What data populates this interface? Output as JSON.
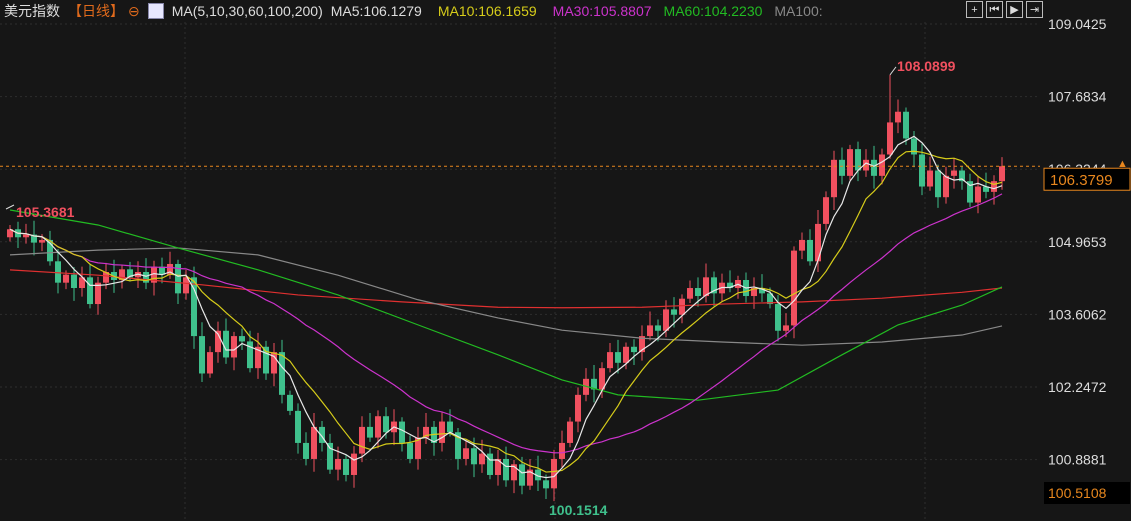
{
  "header": {
    "name": "美元指数",
    "period": "【日线】",
    "ma_label": "MA(5,10,30,60,100,200)",
    "ma5": "MA5:106.1279",
    "ma10": "MA10:106.1659",
    "ma30": "MA30:105.8807",
    "ma60": "MA60:104.2230",
    "ma100": "MA100:"
  },
  "toolbar": {
    "icons": [
      "crosshair-icon",
      "step-back-icon",
      "play-icon",
      "go-end-icon"
    ],
    "glyphs": [
      "+",
      "⏮",
      "▶",
      "⇥"
    ]
  },
  "colors": {
    "up": "#f0505f",
    "down": "#3fc08c",
    "ma5": "#e8e8e8",
    "ma10": "#d6cc1a",
    "ma30": "#cc33cc",
    "ma60": "#22bb22",
    "ma100": "#888888",
    "ma200": "#e03030",
    "accent": "#e8871e"
  },
  "chart_data": {
    "type": "candlestick",
    "yticks": [
      "109.0425",
      "107.6834",
      "106.3244",
      "104.9653",
      "103.6062",
      "102.2472",
      "100.8881"
    ],
    "ylim": [
      99.9,
      109.4
    ],
    "current_price": "106.3799",
    "lower_price": "100.5108",
    "annotations": {
      "high": "108.0899",
      "high_index": 110,
      "low": "100.1514",
      "low_index": 67,
      "left": "105.3681"
    },
    "first_open": 105.05,
    "closes": [
      105.2,
      105.05,
      105.1,
      104.95,
      105.0,
      104.6,
      104.2,
      104.35,
      104.1,
      104.3,
      103.8,
      104.2,
      104.4,
      104.25,
      104.45,
      104.3,
      104.4,
      104.2,
      104.5,
      104.35,
      104.55,
      104.0,
      104.3,
      103.2,
      102.5,
      102.9,
      103.3,
      102.8,
      103.2,
      103.1,
      102.6,
      103.0,
      102.5,
      102.9,
      102.1,
      101.8,
      101.2,
      100.9,
      101.5,
      101.2,
      100.7,
      100.9,
      100.6,
      101.0,
      101.5,
      101.3,
      101.7,
      101.4,
      101.6,
      101.2,
      100.9,
      101.3,
      101.5,
      101.2,
      101.6,
      101.4,
      100.9,
      101.1,
      100.8,
      101.0,
      100.6,
      100.9,
      100.5,
      100.8,
      100.4,
      100.7,
      100.5,
      100.35,
      100.9,
      101.2,
      101.6,
      102.1,
      102.4,
      102.2,
      102.6,
      102.9,
      102.7,
      103.0,
      102.9,
      103.2,
      103.4,
      103.3,
      103.7,
      103.6,
      103.9,
      104.1,
      103.95,
      104.3,
      104.0,
      104.2,
      104.1,
      104.25,
      103.95,
      104.1,
      104.0,
      103.8,
      103.3,
      103.4,
      104.8,
      105.0,
      104.6,
      105.3,
      105.8,
      106.5,
      106.2,
      106.7,
      106.3,
      106.5,
      106.2,
      106.6,
      107.2,
      107.4,
      106.9,
      106.6,
      106.0,
      106.3,
      105.8,
      106.2,
      106.3,
      106.1,
      105.7,
      106.0,
      105.9,
      106.1,
      106.38
    ],
    "ma60": [
      [
        0,
        105.56
      ],
      [
        11,
        105.28
      ],
      [
        21,
        104.85
      ],
      [
        31,
        104.44
      ],
      [
        41,
        103.97
      ],
      [
        51,
        103.41
      ],
      [
        61,
        102.85
      ],
      [
        69,
        102.38
      ],
      [
        76,
        102.1
      ],
      [
        86,
        102.0
      ],
      [
        96,
        102.19
      ],
      [
        104,
        102.85
      ],
      [
        111,
        103.41
      ],
      [
        119,
        103.78
      ],
      [
        124,
        104.12
      ]
    ],
    "ma100": [
      [
        0,
        104.72
      ],
      [
        11,
        104.81
      ],
      [
        21,
        104.85
      ],
      [
        31,
        104.72
      ],
      [
        41,
        104.34
      ],
      [
        51,
        103.88
      ],
      [
        61,
        103.54
      ],
      [
        69,
        103.31
      ],
      [
        79,
        103.16
      ],
      [
        89,
        103.09
      ],
      [
        99,
        103.03
      ],
      [
        109,
        103.09
      ],
      [
        119,
        103.22
      ],
      [
        124,
        103.39
      ]
    ],
    "ma200": [
      [
        0,
        104.44
      ],
      [
        11,
        104.34
      ],
      [
        24,
        104.16
      ],
      [
        36,
        103.97
      ],
      [
        49,
        103.84
      ],
      [
        61,
        103.74
      ],
      [
        69,
        103.73
      ],
      [
        79,
        103.74
      ],
      [
        89,
        103.8
      ],
      [
        99,
        103.84
      ],
      [
        109,
        103.91
      ],
      [
        119,
        104.02
      ],
      [
        124,
        104.1
      ]
    ]
  }
}
